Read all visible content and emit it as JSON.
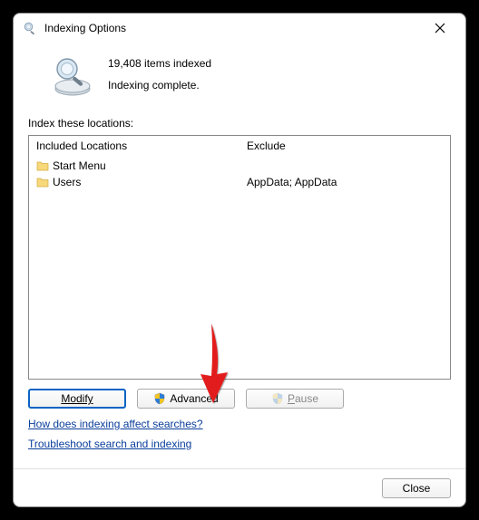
{
  "window": {
    "title": "Indexing Options"
  },
  "status": {
    "count_text": "19,408 items indexed",
    "state_text": "Indexing complete."
  },
  "locations_label": "Index these locations:",
  "columns": {
    "included_header": "Included Locations",
    "exclude_header": "Exclude"
  },
  "rows": [
    {
      "name": "Start Menu",
      "exclude": ""
    },
    {
      "name": "Users",
      "exclude": "AppData; AppData"
    }
  ],
  "buttons": {
    "modify": "Modify",
    "advanced": "Advanced",
    "pause": "Pause",
    "close": "Close"
  },
  "links": {
    "how": "How does indexing affect searches?",
    "troubleshoot": "Troubleshoot search and indexing"
  }
}
